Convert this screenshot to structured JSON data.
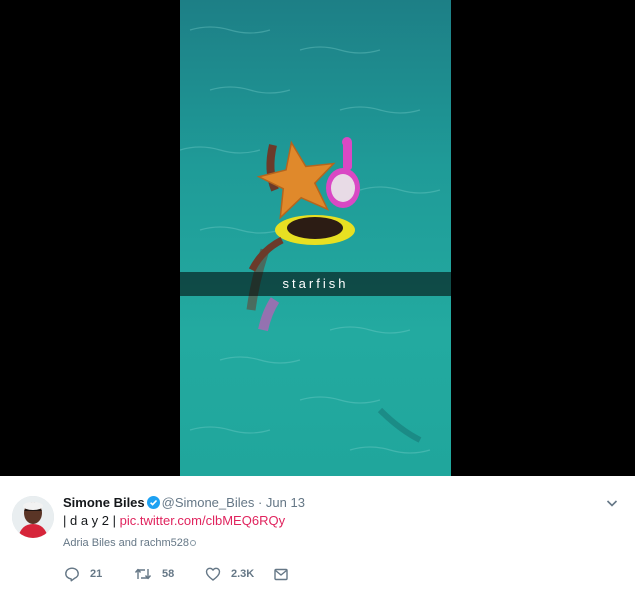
{
  "photo": {
    "caption": "starfish"
  },
  "tweet": {
    "display_name": "Simone Biles",
    "handle": "@Simone_Biles",
    "separator": "·",
    "date": "Jun 13",
    "text_prefix": "| d a y  2 |",
    "link_text": "pic.twitter.com/clbMEQ6RQy",
    "likers": "Adria Biles and rachm528",
    "reply_count": "21",
    "retweet_count": "58",
    "like_count": "2.3K"
  },
  "icons": {
    "verified": "verified-badge-icon",
    "caret": "chevron-down-icon",
    "reply": "reply-icon",
    "retweet": "retweet-icon",
    "like": "heart-icon",
    "dm": "envelope-icon"
  },
  "colors": {
    "link": "#e0245e",
    "verified": "#1da1f2",
    "meta": "#657786",
    "water": "#1f9e9a"
  }
}
